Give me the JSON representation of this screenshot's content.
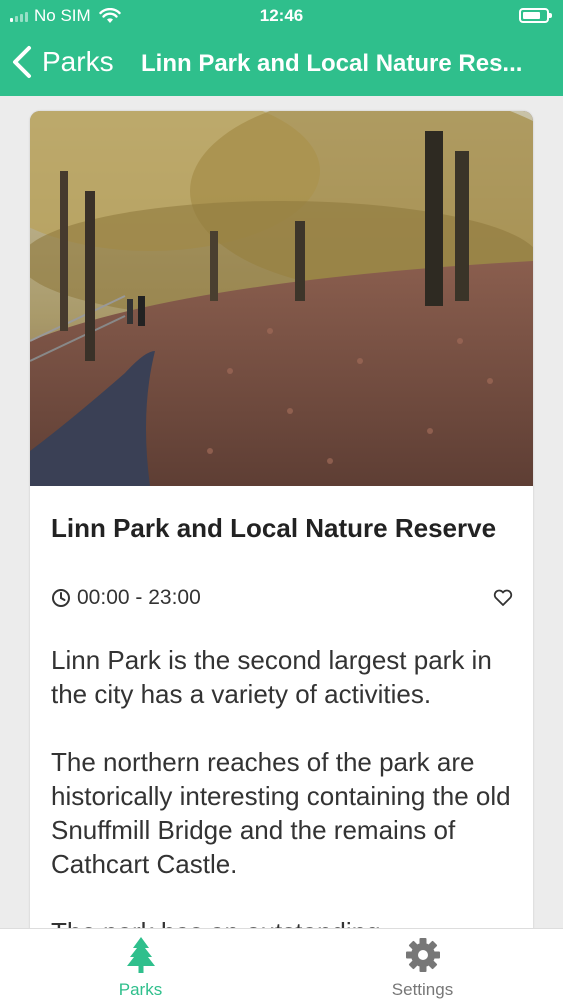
{
  "status_bar": {
    "carrier": "No SIM",
    "time": "12:46"
  },
  "nav": {
    "back_label": "Parks",
    "title": "Linn Park and Local Nature Res..."
  },
  "park": {
    "image_alt": "Autumn woodland path covered in fallen leaves",
    "name": "Linn Park and Local Nature Reserve",
    "hours": "00:00 - 23:00",
    "description": [
      "Linn Park is the second largest park in the city has a variety of activities.",
      "The northern reaches of the park are historically interesting containing the old Snuffmill Bridge and the remains of Cathcart Castle.",
      "The park has an outstanding"
    ]
  },
  "tabs": [
    {
      "label": "Parks",
      "icon": "tree-icon",
      "active": true
    },
    {
      "label": "Settings",
      "icon": "gear-icon",
      "active": false
    }
  ],
  "colors": {
    "accent": "#2fbf8c",
    "inactive_tab": "#777777"
  }
}
